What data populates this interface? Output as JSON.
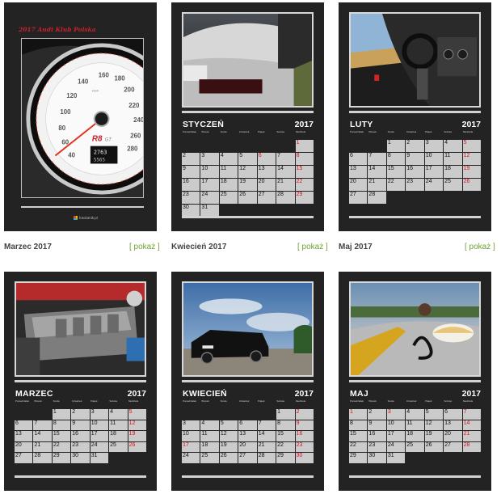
{
  "cover": {
    "title": "2017 Audi Klub Polska",
    "gauge_labels": [
      "40",
      "60",
      "80",
      "100",
      "120",
      "140",
      "160",
      "180",
      "200",
      "220",
      "240",
      "260",
      "280",
      "300",
      "320",
      "340"
    ],
    "gauge_unit": "km/h",
    "badge": "R8 GT",
    "readout_top": "2763",
    "readout_bottom": "5565",
    "logo_text": "fotolotnik.pl"
  },
  "dow_labels": [
    "Poniedziałek",
    "Wtorek",
    "Środa",
    "Czwartek",
    "Piątek",
    "Sobota",
    "Niedziela"
  ],
  "cards_top": [
    {
      "month": "STYCZEŃ",
      "year": "2017",
      "leading_blanks": 6,
      "days": 31,
      "red_days": [
        1,
        6,
        8,
        15,
        22,
        29
      ]
    },
    {
      "month": "LUTY",
      "year": "2017",
      "leading_blanks": 2,
      "days": 28,
      "red_days": [
        5,
        12,
        19,
        26
      ]
    }
  ],
  "cards_bottom": [
    {
      "month": "MARZEC",
      "year": "2017",
      "leading_blanks": 2,
      "days": 31,
      "red_days": [
        5,
        12,
        19,
        26
      ]
    },
    {
      "month": "KWIECIEŃ",
      "year": "2017",
      "leading_blanks": 5,
      "days": 30,
      "red_days": [
        2,
        9,
        16,
        17,
        23,
        30
      ]
    },
    {
      "month": "MAJ",
      "year": "2017",
      "leading_blanks": 0,
      "days": 31,
      "red_days": [
        1,
        3,
        7,
        14,
        21,
        28
      ]
    }
  ],
  "captions": [
    {
      "label": "Marzec 2017",
      "action": "[ pokaż ]"
    },
    {
      "label": "Kwiecień 2017",
      "action": "[ pokaż ]"
    },
    {
      "label": "Maj 2017",
      "action": "[ pokaż ]"
    }
  ],
  "colors": {
    "card_bg": "#232323",
    "cell_bg": "#cbcbcb",
    "holiday_red": "#d8141a",
    "link_green": "#6fa133"
  }
}
